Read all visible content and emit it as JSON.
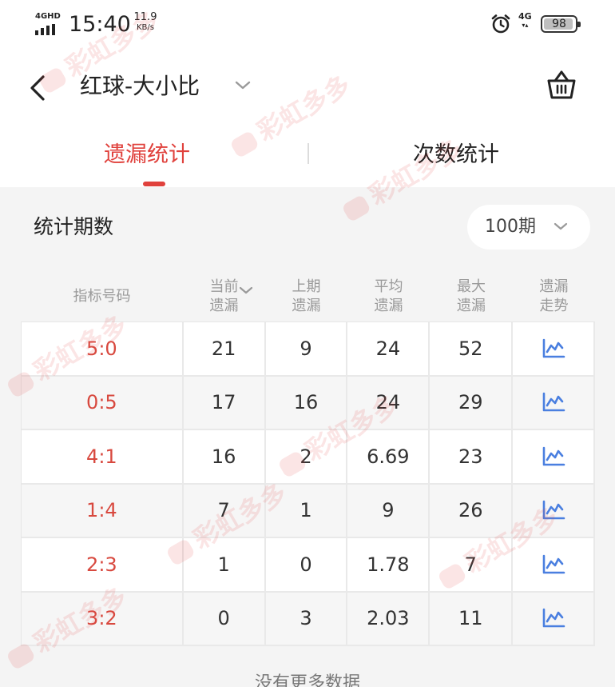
{
  "status_bar": {
    "network_label": "4GHD",
    "time": "15:40",
    "speed_value": "11.9",
    "speed_unit": "KB/s",
    "cellular": "4G",
    "battery": "98",
    "icons": [
      "signal-icon",
      "alarm-icon",
      "battery-icon"
    ]
  },
  "header": {
    "title": "红球-大小比",
    "icons": [
      "back-arrow-icon",
      "chevron-down-icon",
      "basket-icon"
    ]
  },
  "tabs": [
    {
      "label": "遗漏统计",
      "active": true
    },
    {
      "label": "次数统计",
      "active": false
    }
  ],
  "filter": {
    "label": "统计期数",
    "selected": "100期"
  },
  "table": {
    "columns": [
      {
        "line1": "指标号码",
        "line2": ""
      },
      {
        "line1": "当前",
        "line2": "遗漏"
      },
      {
        "line1": "上期",
        "line2": "遗漏"
      },
      {
        "line1": "平均",
        "line2": "遗漏"
      },
      {
        "line1": "最大",
        "line2": "遗漏"
      },
      {
        "line1": "遗漏",
        "line2": "走势"
      }
    ],
    "rows": [
      {
        "index": "5:0",
        "current": "21",
        "previous": "9",
        "average": "24",
        "max": "52"
      },
      {
        "index": "0:5",
        "current": "17",
        "previous": "16",
        "average": "24",
        "max": "29"
      },
      {
        "index": "4:1",
        "current": "16",
        "previous": "2",
        "average": "6.69",
        "max": "23"
      },
      {
        "index": "1:4",
        "current": "7",
        "previous": "1",
        "average": "9",
        "max": "26"
      },
      {
        "index": "2:3",
        "current": "1",
        "previous": "0",
        "average": "1.78",
        "max": "7"
      },
      {
        "index": "3:2",
        "current": "0",
        "previous": "3",
        "average": "2.03",
        "max": "11"
      }
    ]
  },
  "footer": "没有更多数据",
  "watermark": "彩虹多多",
  "colors": {
    "accent": "#e0413c",
    "index_text": "#d8493f",
    "trend_icon": "#4a7fe0",
    "header_text": "#9a9a9a"
  }
}
